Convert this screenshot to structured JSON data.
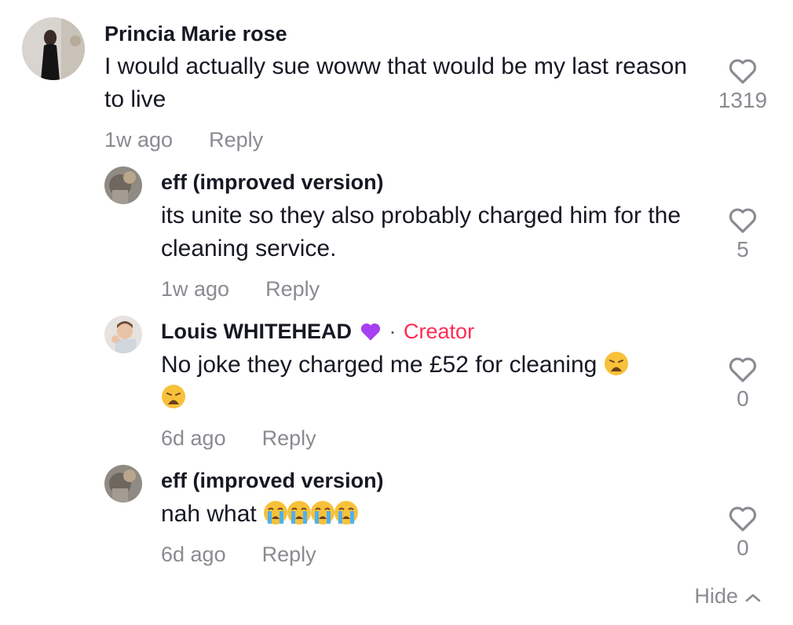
{
  "comments": [
    {
      "username": "Princia Marie rose",
      "text": "I would actually sue woww that would be my last reason to live",
      "time": "1w ago",
      "reply": "Reply",
      "likes": "1319"
    },
    {
      "username": "eff (improved version)",
      "text": "its unite so they also probably charged him for the cleaning service.",
      "time": "1w ago",
      "reply": "Reply",
      "likes": "5"
    },
    {
      "username": "Louis  WHITEHEAD",
      "separator": "·",
      "badge": "Creator",
      "text": "No joke they charged me £52 for cleaning",
      "emoji": "weary-face",
      "time": "6d ago",
      "reply": "Reply",
      "likes": "0"
    },
    {
      "username": "eff (improved version)",
      "text": "nah what",
      "emoji": "loudly-crying-face",
      "time": "6d ago",
      "reply": "Reply",
      "likes": "0"
    }
  ],
  "hide_label": "Hide",
  "colors": {
    "creator": "#fe2c55",
    "meta": "#8a8b91",
    "text": "#161823",
    "purple_heart": "#a640f0"
  }
}
